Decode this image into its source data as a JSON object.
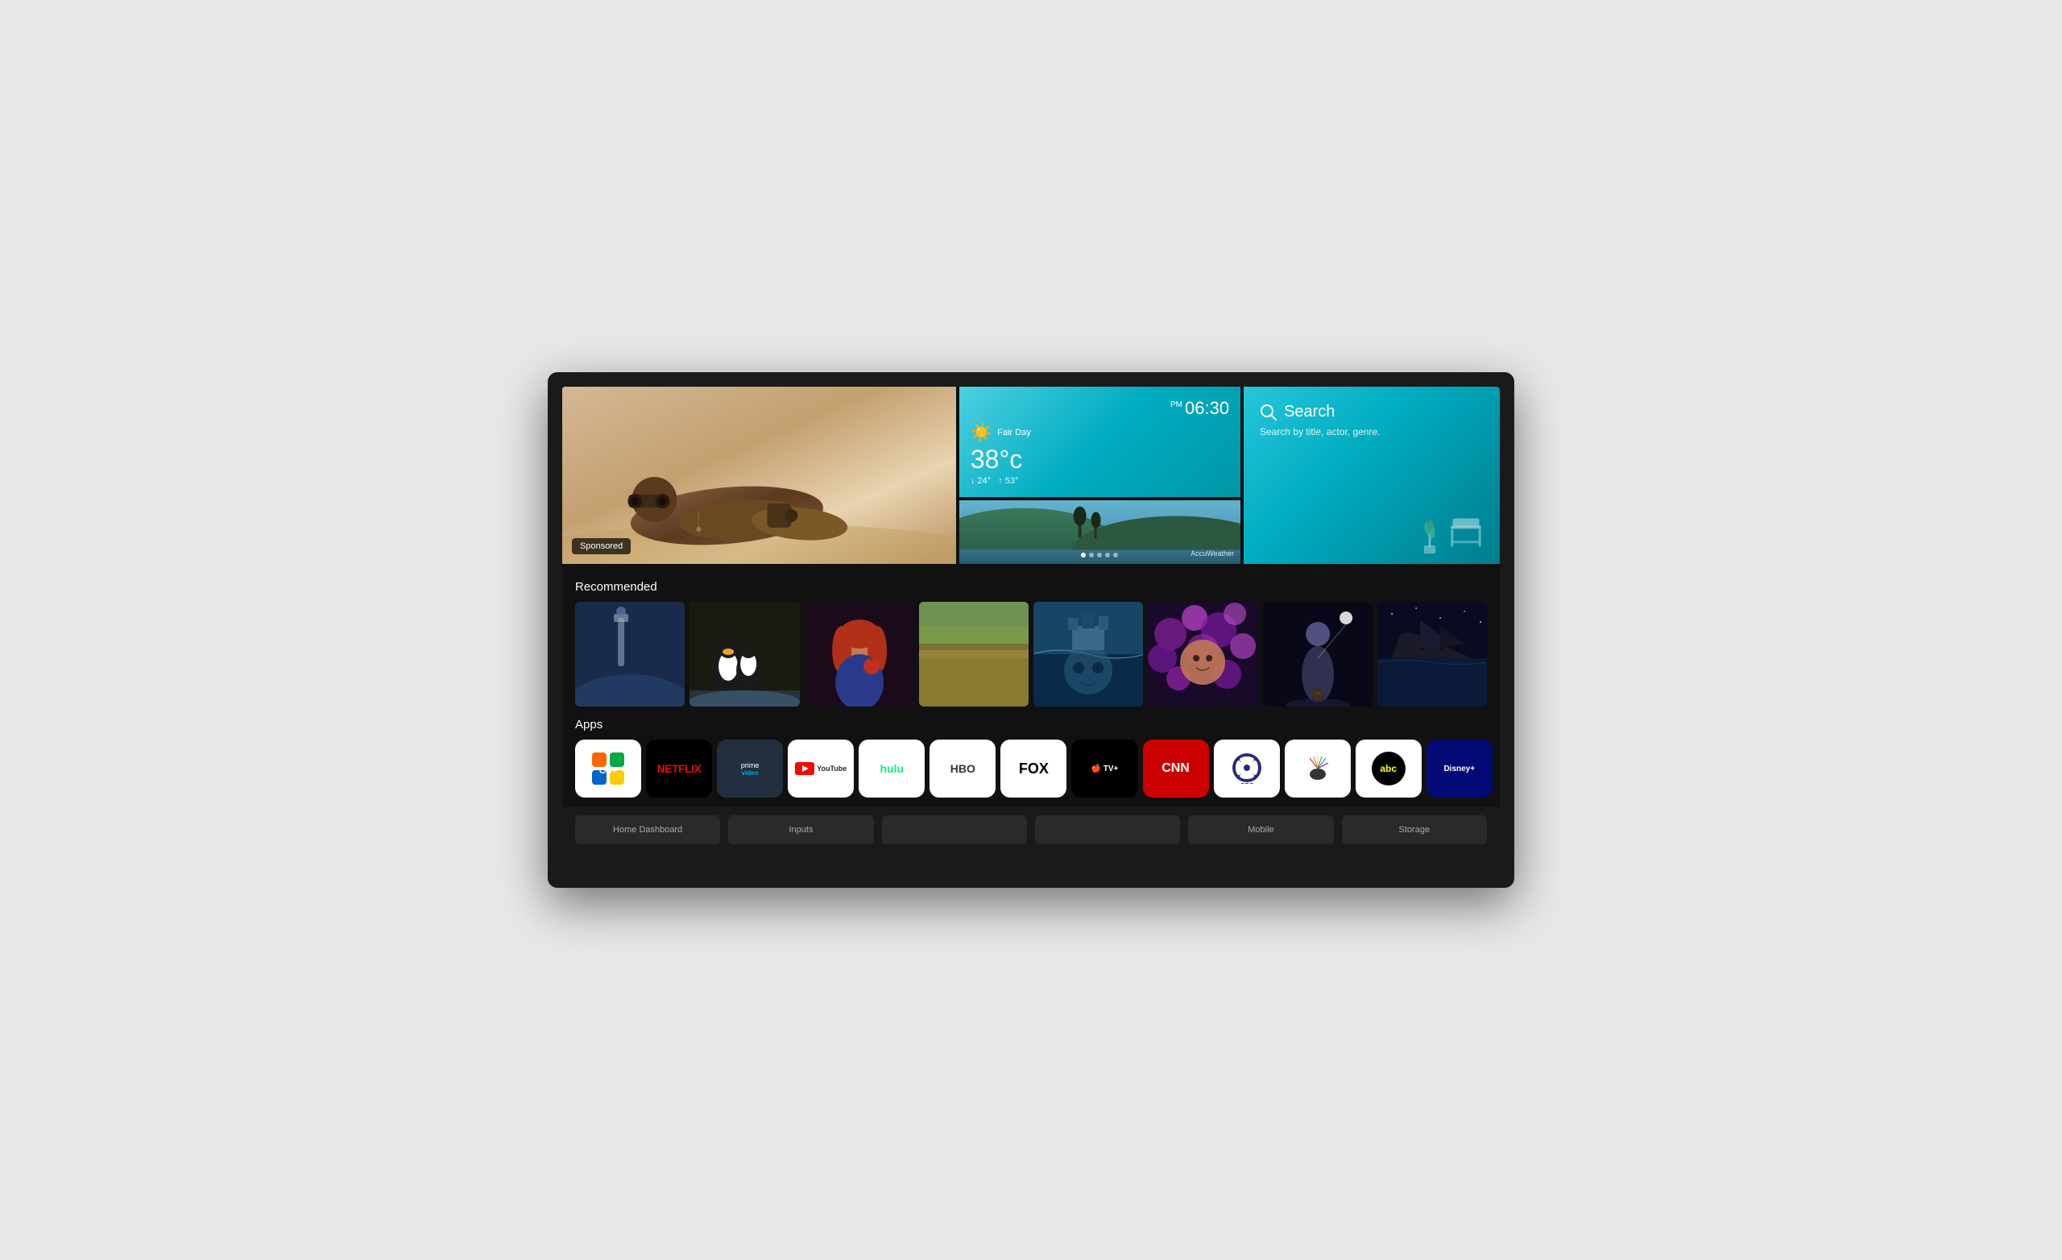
{
  "tv": {
    "hero": {
      "sponsored_label": "Sponsored",
      "weather": {
        "period": "PM",
        "time": "06:30",
        "condition": "Fair Day",
        "temp": "38°c",
        "low": "↓ 24°",
        "high": "↑ 53°",
        "provider": "AccuWeather"
      },
      "search": {
        "title": "Search",
        "subtitle": "Search by title, actor, genre."
      }
    },
    "sections": {
      "recommended_title": "Recommended",
      "apps_title": "Apps"
    },
    "apps": [
      {
        "id": "ch",
        "label": "CH"
      },
      {
        "id": "netflix",
        "label": "NETFLIX"
      },
      {
        "id": "prime",
        "label": "prime video"
      },
      {
        "id": "youtube",
        "label": "YouTube"
      },
      {
        "id": "hulu",
        "label": "hulu"
      },
      {
        "id": "hbo",
        "label": "HBO"
      },
      {
        "id": "fox",
        "label": "FOX"
      },
      {
        "id": "appletv",
        "label": "Apple TV+"
      },
      {
        "id": "cnn",
        "label": "CNN"
      },
      {
        "id": "cbs",
        "label": "CBS"
      },
      {
        "id": "nbc",
        "label": "NBC NEWS"
      },
      {
        "id": "abc",
        "label": "abc"
      },
      {
        "id": "disney",
        "label": "Disney+"
      }
    ],
    "bottom_nav": [
      {
        "id": "home",
        "label": "Home Dashboard"
      },
      {
        "id": "inputs",
        "label": "Inputs"
      },
      {
        "id": "blank1",
        "label": ""
      },
      {
        "id": "blank2",
        "label": ""
      },
      {
        "id": "mobile",
        "label": "Mobile"
      },
      {
        "id": "storage",
        "label": "Storage"
      }
    ]
  }
}
